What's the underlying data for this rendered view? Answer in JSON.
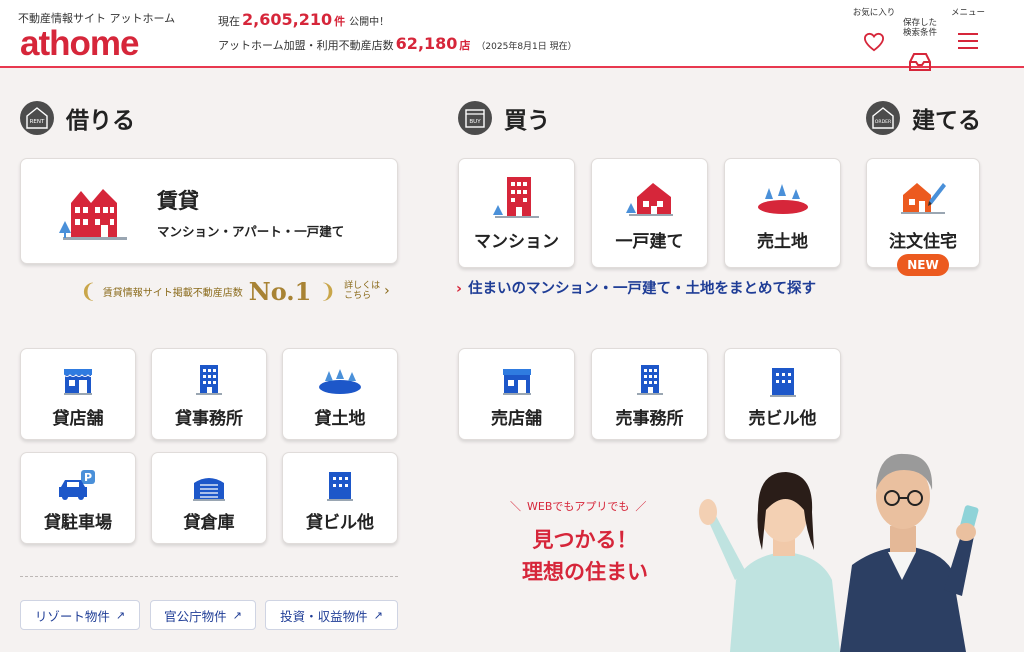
{
  "header": {
    "tagline": "不動産情報サイト アットホーム",
    "logo": "athome",
    "listings_prefix": "現在",
    "listings_count": "2,605,210",
    "listings_unit": "件",
    "listings_suffix": "公開中！",
    "stores_prefix": "アットホーム加盟・利用不動産店数",
    "stores_count": "62,180",
    "stores_unit": "店",
    "stores_date": "（2025年8月1日 現在）",
    "nav": [
      {
        "label": "お気に入り",
        "icon": "heart-icon"
      },
      {
        "label": "保存した\n検索条件",
        "icon": "inbox-icon"
      },
      {
        "label": "メニュー",
        "icon": "menu-icon"
      }
    ]
  },
  "rent": {
    "badge": "RENT",
    "title": "借りる",
    "main_card": {
      "label": "賃貸",
      "sub": "マンション・アパート・一戸建て"
    },
    "no1": {
      "text": "賃貸情報サイト掲載不動産店数",
      "rank": "No.1",
      "more": "詳しくは\nこちら"
    },
    "items": [
      "貸店舗",
      "貸事務所",
      "貸土地",
      "貸駐車場",
      "貸倉庫",
      "貸ビル他"
    ],
    "links": [
      "リゾート物件",
      "官公庁物件",
      "投資・収益物件"
    ]
  },
  "buy": {
    "badge": "BUY",
    "title": "買う",
    "items": [
      "マンション",
      "一戸建て",
      "売土地"
    ],
    "link": "住まいのマンション・一戸建て・土地をまとめて探す",
    "items2": [
      "売店舗",
      "売事務所",
      "売ビル他"
    ]
  },
  "build": {
    "badge": "ORDER",
    "title": "建てる",
    "item": "注文住宅",
    "new_badge": "NEW"
  },
  "promo": {
    "line1": "WEBでもアプリでも",
    "line2": "見つかる！",
    "line3": "理想の住まい"
  },
  "colors": {
    "brand": "#d6263a",
    "blue": "#1f3d96",
    "new": "#ec5a1f"
  }
}
